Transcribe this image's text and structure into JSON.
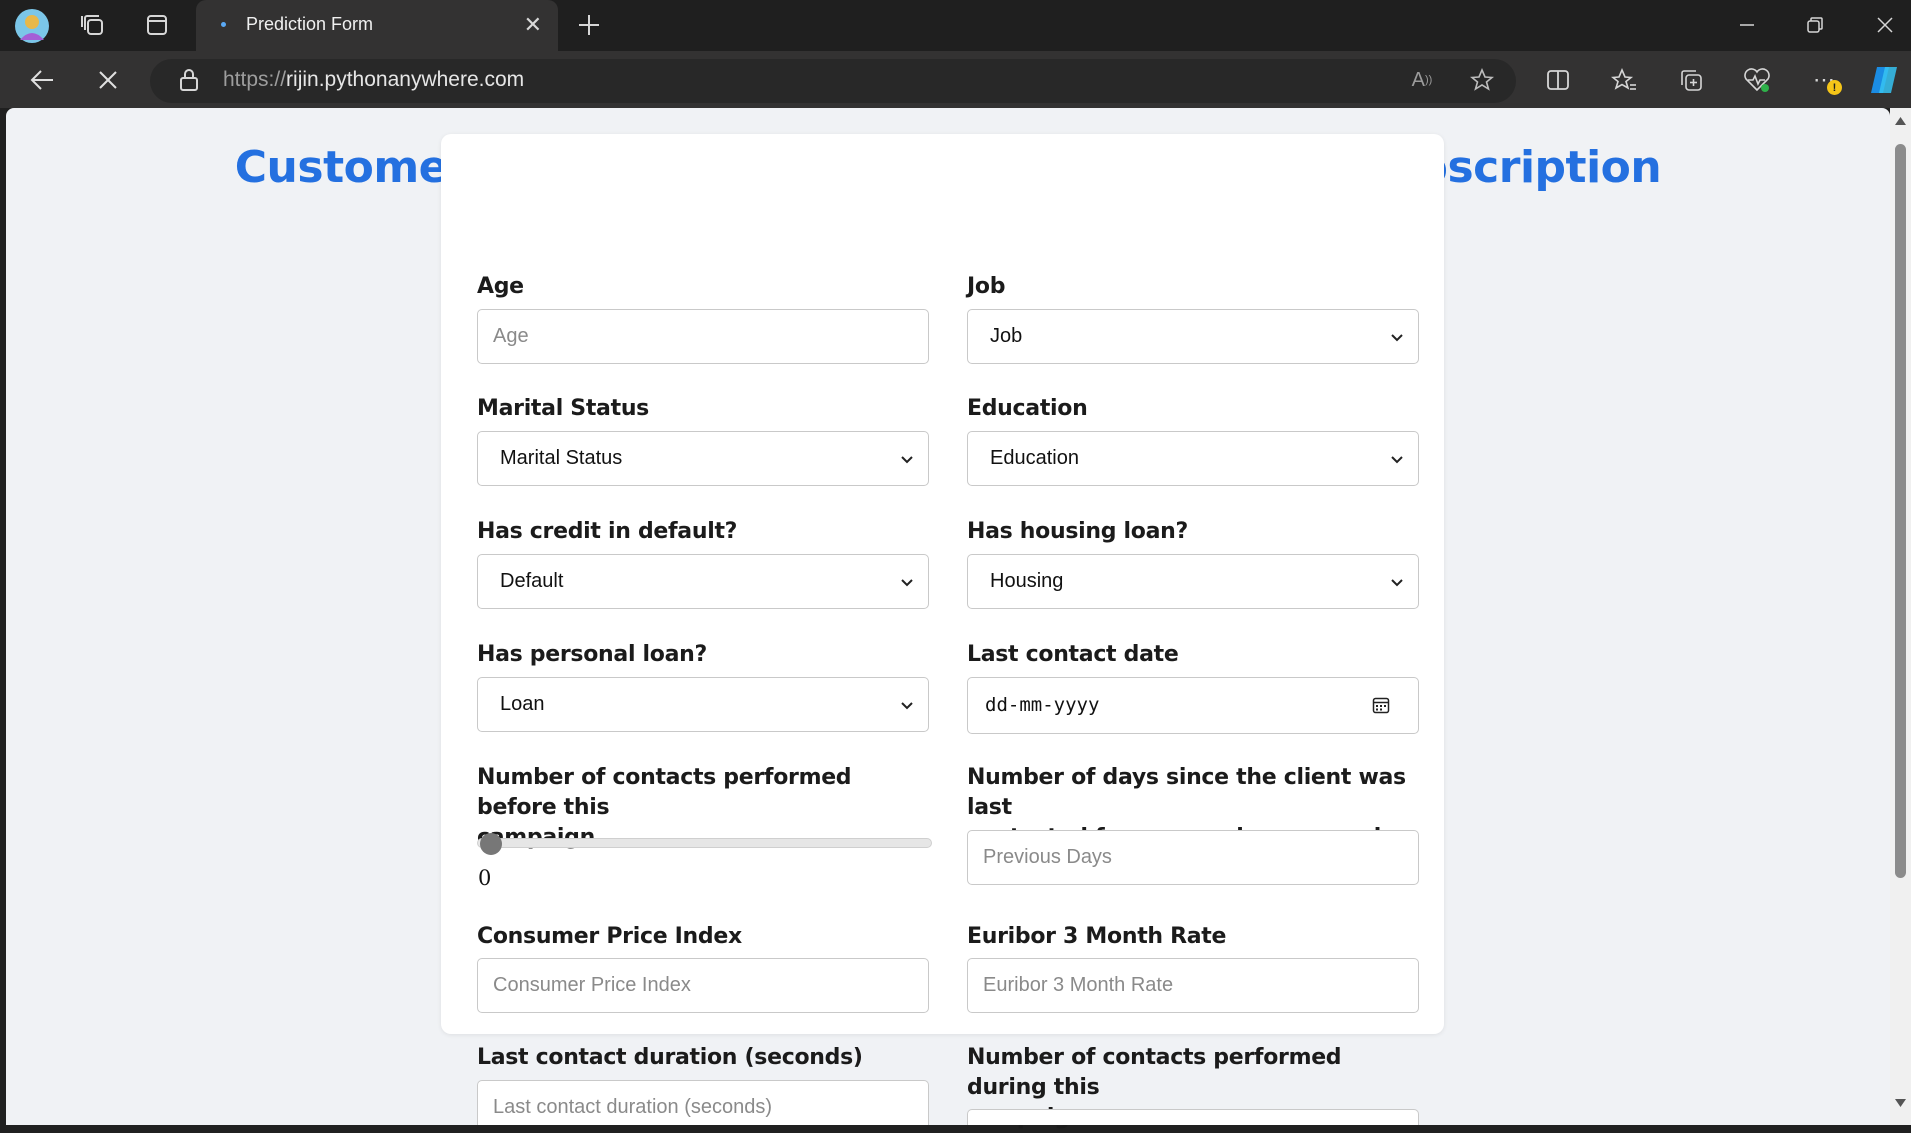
{
  "browser": {
    "tab_title": "Prediction Form",
    "url_scheme": "https://",
    "url_host": "rijin.pythonanywhere.com"
  },
  "page": {
    "heading": "Customer Details for Predicting Term Deposit Subscription"
  },
  "form": {
    "age": {
      "label": "Age",
      "placeholder": "Age"
    },
    "job": {
      "label": "Job",
      "value": "Job"
    },
    "marital": {
      "label": "Marital Status",
      "value": "Marital Status"
    },
    "education": {
      "label": "Education",
      "value": "Education"
    },
    "default": {
      "label": "Has credit in default?",
      "value": "Default"
    },
    "housing": {
      "label": "Has housing loan?",
      "value": "Housing"
    },
    "loan": {
      "label": "Has personal loan?",
      "value": "Loan"
    },
    "contact_date": {
      "label": "Last contact date",
      "value": "dd-mm-yyyy"
    },
    "previous": {
      "label_line1": "Number of contacts performed before this",
      "label_line2": "campaign",
      "value": "0",
      "slider_fraction": 0
    },
    "pdays": {
      "label_line1": "Number of days since the client was last",
      "label_line2": "contacted from a previous campaign",
      "placeholder": "Previous Days"
    },
    "cpi": {
      "label": "Consumer Price Index",
      "placeholder": "Consumer Price Index"
    },
    "euribor": {
      "label": "Euribor 3 Month Rate",
      "placeholder": "Euribor 3 Month Rate"
    },
    "duration": {
      "label": "Last contact duration (seconds)",
      "placeholder": "Last contact duration (seconds)"
    },
    "campaign": {
      "label_line1": "Number of contacts performed during this",
      "label_line2": "campaign"
    }
  },
  "colors": {
    "heading": "#2470e0",
    "page_bg": "#f0f2f5",
    "browser_bg": "#1f1f1f"
  }
}
